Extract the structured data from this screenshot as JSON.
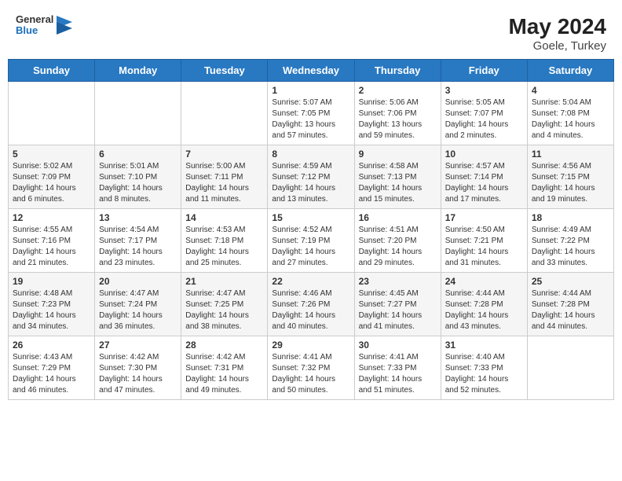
{
  "header": {
    "logo_line1": "General",
    "logo_line2": "Blue",
    "month_year": "May 2024",
    "location": "Goele, Turkey"
  },
  "days_of_week": [
    "Sunday",
    "Monday",
    "Tuesday",
    "Wednesday",
    "Thursday",
    "Friday",
    "Saturday"
  ],
  "weeks": [
    [
      {
        "day": "",
        "info": ""
      },
      {
        "day": "",
        "info": ""
      },
      {
        "day": "",
        "info": ""
      },
      {
        "day": "1",
        "info": "Sunrise: 5:07 AM\nSunset: 7:05 PM\nDaylight: 13 hours and 57 minutes."
      },
      {
        "day": "2",
        "info": "Sunrise: 5:06 AM\nSunset: 7:06 PM\nDaylight: 13 hours and 59 minutes."
      },
      {
        "day": "3",
        "info": "Sunrise: 5:05 AM\nSunset: 7:07 PM\nDaylight: 14 hours and 2 minutes."
      },
      {
        "day": "4",
        "info": "Sunrise: 5:04 AM\nSunset: 7:08 PM\nDaylight: 14 hours and 4 minutes."
      }
    ],
    [
      {
        "day": "5",
        "info": "Sunrise: 5:02 AM\nSunset: 7:09 PM\nDaylight: 14 hours and 6 minutes."
      },
      {
        "day": "6",
        "info": "Sunrise: 5:01 AM\nSunset: 7:10 PM\nDaylight: 14 hours and 8 minutes."
      },
      {
        "day": "7",
        "info": "Sunrise: 5:00 AM\nSunset: 7:11 PM\nDaylight: 14 hours and 11 minutes."
      },
      {
        "day": "8",
        "info": "Sunrise: 4:59 AM\nSunset: 7:12 PM\nDaylight: 14 hours and 13 minutes."
      },
      {
        "day": "9",
        "info": "Sunrise: 4:58 AM\nSunset: 7:13 PM\nDaylight: 14 hours and 15 minutes."
      },
      {
        "day": "10",
        "info": "Sunrise: 4:57 AM\nSunset: 7:14 PM\nDaylight: 14 hours and 17 minutes."
      },
      {
        "day": "11",
        "info": "Sunrise: 4:56 AM\nSunset: 7:15 PM\nDaylight: 14 hours and 19 minutes."
      }
    ],
    [
      {
        "day": "12",
        "info": "Sunrise: 4:55 AM\nSunset: 7:16 PM\nDaylight: 14 hours and 21 minutes."
      },
      {
        "day": "13",
        "info": "Sunrise: 4:54 AM\nSunset: 7:17 PM\nDaylight: 14 hours and 23 minutes."
      },
      {
        "day": "14",
        "info": "Sunrise: 4:53 AM\nSunset: 7:18 PM\nDaylight: 14 hours and 25 minutes."
      },
      {
        "day": "15",
        "info": "Sunrise: 4:52 AM\nSunset: 7:19 PM\nDaylight: 14 hours and 27 minutes."
      },
      {
        "day": "16",
        "info": "Sunrise: 4:51 AM\nSunset: 7:20 PM\nDaylight: 14 hours and 29 minutes."
      },
      {
        "day": "17",
        "info": "Sunrise: 4:50 AM\nSunset: 7:21 PM\nDaylight: 14 hours and 31 minutes."
      },
      {
        "day": "18",
        "info": "Sunrise: 4:49 AM\nSunset: 7:22 PM\nDaylight: 14 hours and 33 minutes."
      }
    ],
    [
      {
        "day": "19",
        "info": "Sunrise: 4:48 AM\nSunset: 7:23 PM\nDaylight: 14 hours and 34 minutes."
      },
      {
        "day": "20",
        "info": "Sunrise: 4:47 AM\nSunset: 7:24 PM\nDaylight: 14 hours and 36 minutes."
      },
      {
        "day": "21",
        "info": "Sunrise: 4:47 AM\nSunset: 7:25 PM\nDaylight: 14 hours and 38 minutes."
      },
      {
        "day": "22",
        "info": "Sunrise: 4:46 AM\nSunset: 7:26 PM\nDaylight: 14 hours and 40 minutes."
      },
      {
        "day": "23",
        "info": "Sunrise: 4:45 AM\nSunset: 7:27 PM\nDaylight: 14 hours and 41 minutes."
      },
      {
        "day": "24",
        "info": "Sunrise: 4:44 AM\nSunset: 7:28 PM\nDaylight: 14 hours and 43 minutes."
      },
      {
        "day": "25",
        "info": "Sunrise: 4:44 AM\nSunset: 7:28 PM\nDaylight: 14 hours and 44 minutes."
      }
    ],
    [
      {
        "day": "26",
        "info": "Sunrise: 4:43 AM\nSunset: 7:29 PM\nDaylight: 14 hours and 46 minutes."
      },
      {
        "day": "27",
        "info": "Sunrise: 4:42 AM\nSunset: 7:30 PM\nDaylight: 14 hours and 47 minutes."
      },
      {
        "day": "28",
        "info": "Sunrise: 4:42 AM\nSunset: 7:31 PM\nDaylight: 14 hours and 49 minutes."
      },
      {
        "day": "29",
        "info": "Sunrise: 4:41 AM\nSunset: 7:32 PM\nDaylight: 14 hours and 50 minutes."
      },
      {
        "day": "30",
        "info": "Sunrise: 4:41 AM\nSunset: 7:33 PM\nDaylight: 14 hours and 51 minutes."
      },
      {
        "day": "31",
        "info": "Sunrise: 4:40 AM\nSunset: 7:33 PM\nDaylight: 14 hours and 52 minutes."
      },
      {
        "day": "",
        "info": ""
      }
    ]
  ]
}
